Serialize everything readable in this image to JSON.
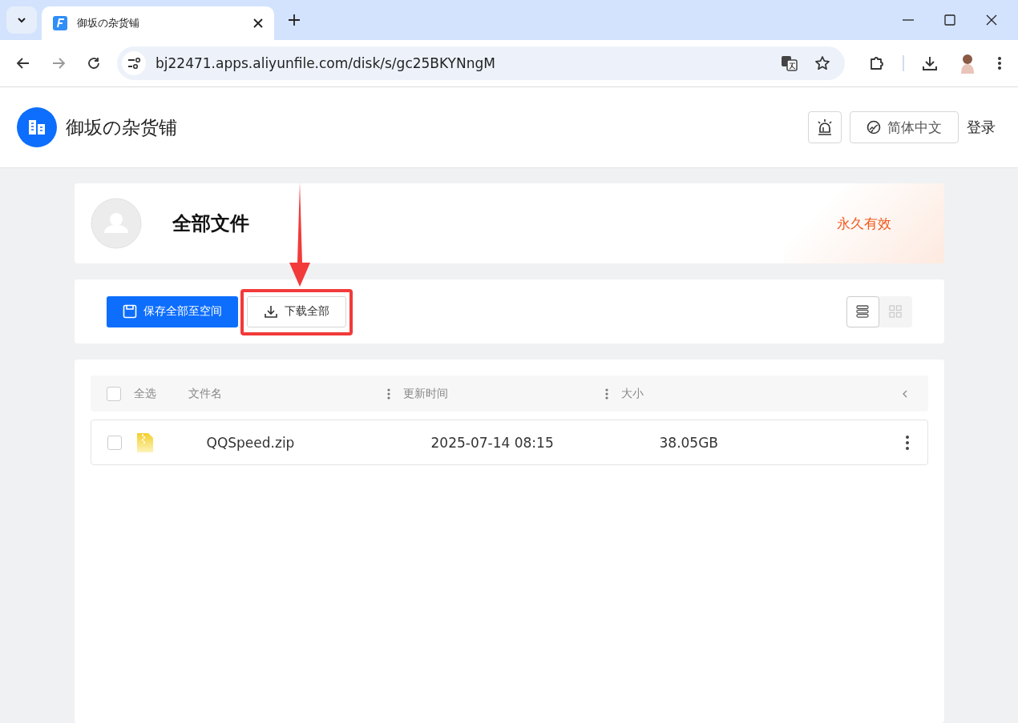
{
  "browser": {
    "tab_title": "御坂の杂货铺",
    "url": "bj22471.apps.aliyunfile.com/disk/s/gc25BKYNngM"
  },
  "site": {
    "name": "御坂の杂货铺",
    "language": "简体中文",
    "login": "登录"
  },
  "share": {
    "title": "全部文件",
    "validity": "永久有效"
  },
  "actions": {
    "save": "保存全部至空间",
    "download": "下载全部",
    "highlighted": true
  },
  "views": [
    {
      "kind": "list",
      "selected": true
    },
    {
      "kind": "grid",
      "selected": false
    }
  ],
  "table": {
    "select_all": {
      "label": "全选",
      "checked": false
    },
    "columns": [
      "文件名",
      "更新时间",
      "大小"
    ],
    "rows": [
      {
        "name": "QQSpeed.zip",
        "updated": "2025-07-14 08:15",
        "size": "38.05GB",
        "checked": false
      }
    ]
  }
}
